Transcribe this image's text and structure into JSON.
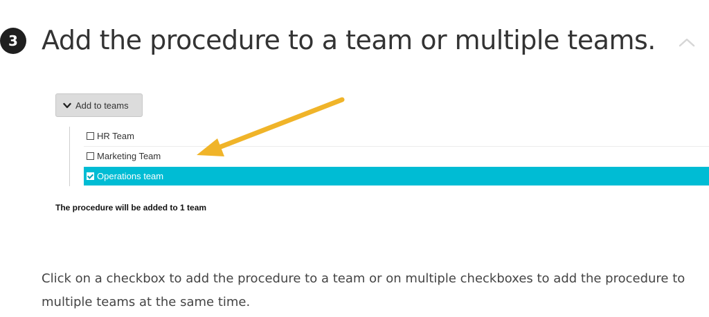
{
  "step": {
    "number": "3",
    "title": "Add the procedure to a team or multiple teams.",
    "collapse_icon": "chevron-up-icon"
  },
  "add_to_teams": {
    "label": "Add to teams",
    "icon": "chevron-down-icon"
  },
  "teams": [
    {
      "label": "HR Team",
      "checked": false
    },
    {
      "label": "Marketing Team",
      "checked": false
    },
    {
      "label": "Operations team",
      "checked": true
    }
  ],
  "summary": "The procedure will be added to 1 team",
  "description": "Click on a checkbox to add the procedure to a team or on multiple checkboxes to add the procedure to multiple teams at the same time.",
  "colors": {
    "selected_row": "#00bcd4",
    "arrow": "#f0b429",
    "badge": "#1f1f1f"
  }
}
